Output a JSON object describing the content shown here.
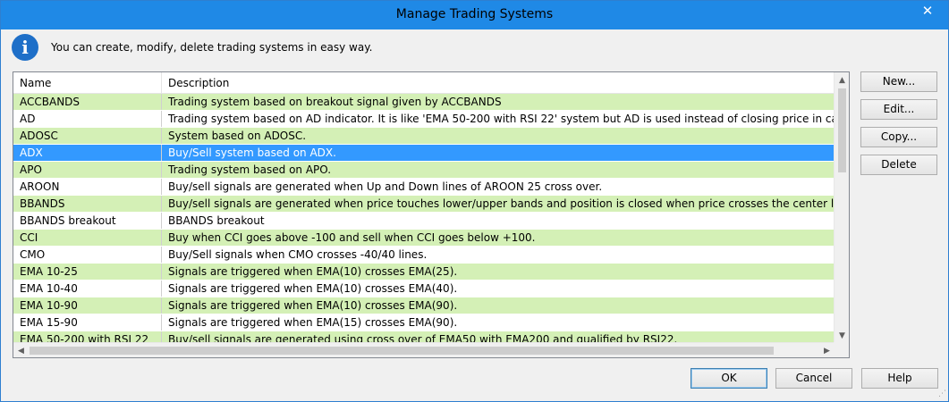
{
  "window": {
    "title": "Manage Trading Systems",
    "close_symbol": "✕"
  },
  "info": {
    "message": "You can create, modify, delete trading systems in easy way.",
    "icon_glyph": "i"
  },
  "grid": {
    "columns": [
      "Name",
      "Description"
    ],
    "rows": [
      {
        "name": "ACCBANDS",
        "description": "Trading system based on breakout signal given by ACCBANDS",
        "style": "green"
      },
      {
        "name": "AD",
        "description": "Trading system based on AD indicator. It is like 'EMA 50-200 with RSI 22' system but AD is used instead of closing price in calculation of EMA a",
        "style": "white"
      },
      {
        "name": "ADOSC",
        "description": "System based on ADOSC.",
        "style": "green"
      },
      {
        "name": "ADX",
        "description": "Buy/Sell system based on ADX.",
        "style": "selected"
      },
      {
        "name": "APO",
        "description": "Trading system based on APO.",
        "style": "green"
      },
      {
        "name": "AROON",
        "description": "Buy/sell signals are generated when Up and Down lines of AROON 25 cross over.",
        "style": "white"
      },
      {
        "name": "BBANDS",
        "description": "Buy/sell signals are generated when price touches lower/upper bands and position is closed when price crosses the center line.",
        "style": "green"
      },
      {
        "name": "BBANDS breakout",
        "description": "BBANDS breakout",
        "style": "white"
      },
      {
        "name": "CCI",
        "description": "Buy when CCI goes above -100 and sell when CCI goes below +100.",
        "style": "green"
      },
      {
        "name": "CMO",
        "description": "Buy/Sell signals when CMO crosses -40/40 lines.",
        "style": "white"
      },
      {
        "name": "EMA 10-25",
        "description": "Signals are triggered when EMA(10) crosses EMA(25).",
        "style": "green"
      },
      {
        "name": "EMA 10-40",
        "description": "Signals are triggered when EMA(10) crosses EMA(40).",
        "style": "white"
      },
      {
        "name": "EMA 10-90",
        "description": "Signals are triggered when EMA(10) crosses EMA(90).",
        "style": "green"
      },
      {
        "name": "EMA 15-90",
        "description": "Signals are triggered when EMA(15) crosses EMA(90).",
        "style": "white"
      },
      {
        "name": "EMA 50-200 with RSI 22",
        "description": "Buy/sell signals are generated using cross over of EMA50 with EMA200 and qualified by RSI22.",
        "style": "green"
      }
    ]
  },
  "side_buttons": {
    "new": "New...",
    "edit": "Edit...",
    "copy": "Copy...",
    "delete": "Delete"
  },
  "footer_buttons": {
    "ok": "OK",
    "cancel": "Cancel",
    "help": "Help"
  },
  "scroll_glyphs": {
    "up": "▲",
    "down": "▼",
    "left": "◀",
    "right": "▶"
  },
  "colors": {
    "titlebar": "#1f89e6",
    "row_green": "#d4f0b6",
    "row_selected": "#3399ff"
  }
}
